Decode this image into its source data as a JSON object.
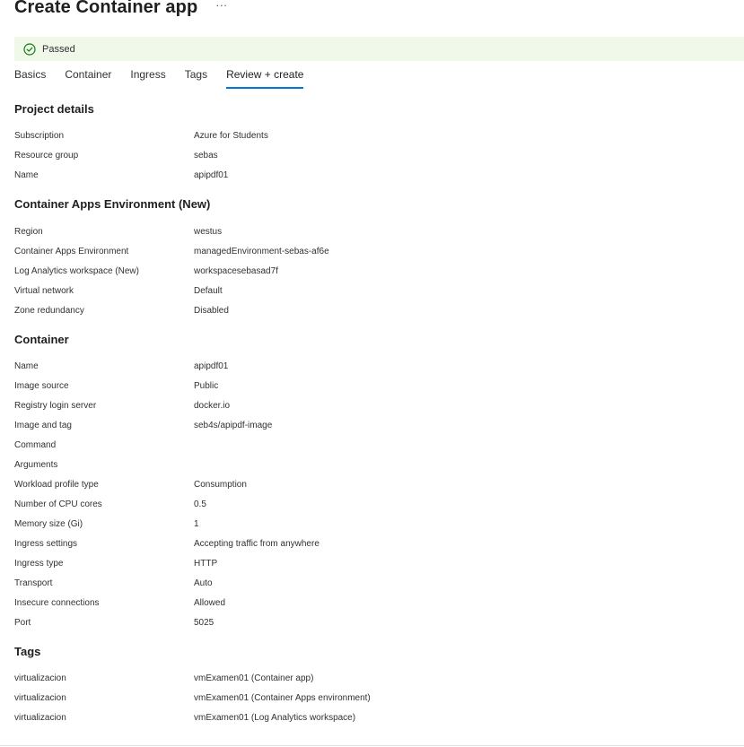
{
  "header": {
    "title": "Create Container app",
    "more_label": "···"
  },
  "status": {
    "text": "Passed",
    "icon": "check-circle-icon",
    "color": "#107c10"
  },
  "tabs": [
    {
      "label": "Basics"
    },
    {
      "label": "Container"
    },
    {
      "label": "Ingress"
    },
    {
      "label": "Tags"
    },
    {
      "label": "Review + create"
    }
  ],
  "active_tab": "Review + create",
  "accent_color": "#0078d4",
  "sections": {
    "project": {
      "title": "Project details",
      "rows": [
        {
          "label": "Subscription",
          "value": "Azure for Students"
        },
        {
          "label": "Resource group",
          "value": "sebas"
        },
        {
          "label": "Name",
          "value": "apipdf01"
        }
      ]
    },
    "environment": {
      "title": "Container Apps Environment (New)",
      "rows": [
        {
          "label": "Region",
          "value": "westus"
        },
        {
          "label": "Container Apps Environment",
          "value": "managedEnvironment-sebas-af6e"
        },
        {
          "label": "Log Analytics workspace (New)",
          "value": "workspacesebasad7f"
        },
        {
          "label": "Virtual network",
          "value": "Default"
        },
        {
          "label": "Zone redundancy",
          "value": "Disabled"
        }
      ]
    },
    "container": {
      "title": "Container",
      "rows": [
        {
          "label": "Name",
          "value": "apipdf01"
        },
        {
          "label": "Image source",
          "value": "Public"
        },
        {
          "label": "Registry login server",
          "value": "docker.io"
        },
        {
          "label": "Image and tag",
          "value": "seb4s/apipdf-image"
        },
        {
          "label": "Command",
          "value": ""
        },
        {
          "label": "Arguments",
          "value": ""
        },
        {
          "label": "Workload profile type",
          "value": "Consumption"
        },
        {
          "label": "Number of CPU cores",
          "value": "0.5"
        },
        {
          "label": "Memory size (Gi)",
          "value": "1"
        },
        {
          "label": "Ingress settings",
          "value": "Accepting traffic from anywhere"
        },
        {
          "label": "Ingress type",
          "value": "HTTP"
        },
        {
          "label": "Transport",
          "value": "Auto"
        },
        {
          "label": "Insecure connections",
          "value": "Allowed"
        },
        {
          "label": "Port",
          "value": "5025"
        }
      ]
    },
    "tags": {
      "title": "Tags",
      "rows": [
        {
          "label": "virtualizacion",
          "value": "vmExamen01 (Container app)"
        },
        {
          "label": "virtualizacion",
          "value": "vmExamen01 (Container Apps environment)"
        },
        {
          "label": "virtualizacion",
          "value": "vmExamen01 (Log Analytics workspace)"
        }
      ]
    }
  }
}
